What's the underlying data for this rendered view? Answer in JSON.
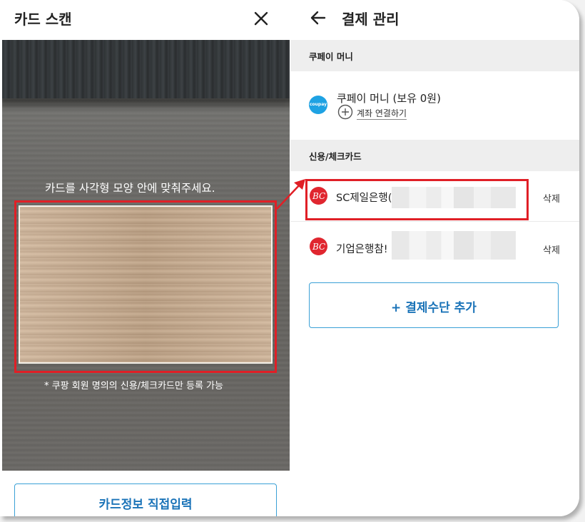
{
  "left_panel": {
    "title": "카드 스캔",
    "close_icon": "close-icon",
    "scan_instruction": "카드를 사각형 모양 안에 맞춰주세요.",
    "note": "* 쿠팡 회원 명의의 신용/체크카드만 등록 가능",
    "manual_entry_label": "카드정보 직접입력"
  },
  "right_panel": {
    "back_icon": "arrow-left-icon",
    "title": "결제 관리",
    "sections": {
      "money": "쿠페이 머니",
      "cards": "신용/체크카드"
    },
    "coupay": {
      "logo_text": "coupay",
      "label": "쿠페이 머니 (보유 0원)",
      "link_label": "계좌 연결하기"
    },
    "cards": [
      {
        "logo": "BC",
        "name": "SC제일은행(",
        "delete_label": "삭제"
      },
      {
        "logo": "BC",
        "name": "기업은행참!",
        "delete_label": "삭제"
      }
    ],
    "add_payment_label": "+ 결제수단 추가"
  },
  "colors": {
    "accent": "#1a73b8",
    "button_border": "#3aa0d6",
    "highlight": "#e01f26",
    "bc_red": "#e0262f",
    "coupay_blue": "#1ea2e3"
  }
}
